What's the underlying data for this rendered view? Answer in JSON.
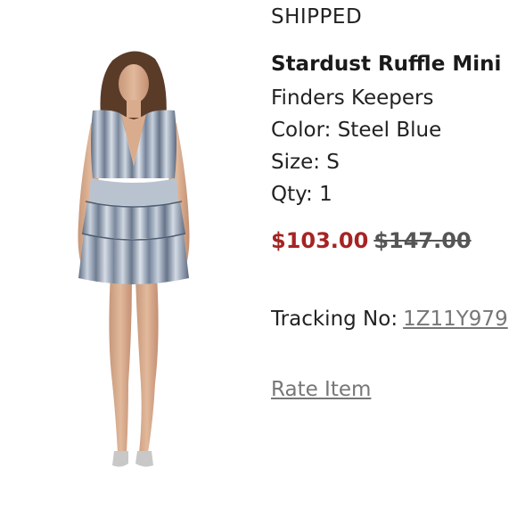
{
  "order": {
    "status": "SHIPPED",
    "title": "Stardust Ruffle Mini",
    "brand": "Finders Keepers",
    "color_text": "Color: Steel Blue",
    "size_text": "Size: S",
    "qty_text": "Qty: 1",
    "price_sale": "$103.00",
    "price_original": "$147.00",
    "tracking_label": "Tracking No:",
    "tracking_number": "1Z11Y979",
    "rate_item": "Rate Item"
  },
  "colors": {
    "sale_price": "#a52424",
    "link_gray": "#777777",
    "dress_steel_blue": "#8a9ab0"
  },
  "image": {
    "subject": "model-in-dress-icon"
  }
}
